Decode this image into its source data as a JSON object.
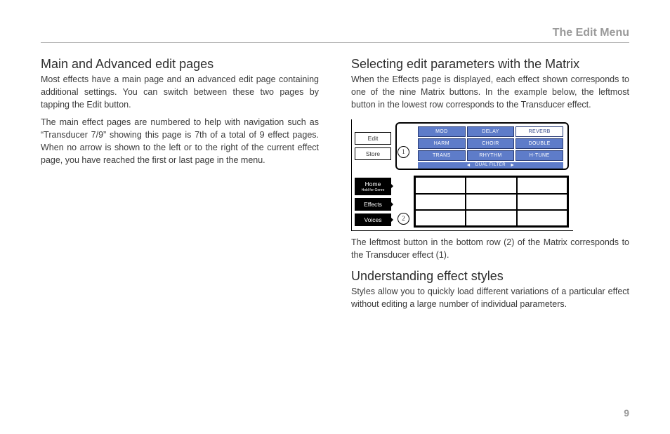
{
  "header": {
    "title": "The Edit Menu"
  },
  "left": {
    "sec1": {
      "title": "Main and Advanced edit pages",
      "p1": "Most effects have a main page and an advanced edit page containing additional settings. You can switch between these two pages by tapping the Edit button.",
      "p2": "The main effect pages are numbered to help with navigation such as “Transducer 7/9” showing this page is 7th of a total of 9 effect pages. When no arrow is shown to the left or to the right of the current effect page, you have reached the first or last page in the menu."
    }
  },
  "right": {
    "sec1": {
      "title": "Selecting edit parameters with the Matrix",
      "p1": "When the Effects page is displayed, each effect shown corresponds to one of the nine Matrix buttons. In the example below, the leftmost button in the lowest row corresponds to the Transducer effect."
    },
    "caption": "The leftmost button in the bottom row (2) of the Matrix corresponds to the Transducer effect (1).",
    "sec2": {
      "title": "Understanding effect styles",
      "p1": "Styles allow you to quickly load different variations of a particular effect without editing a large number of individual parameters."
    }
  },
  "device": {
    "sideTop": {
      "edit": "Edit",
      "store": "Store"
    },
    "sideBottom": {
      "home": "Home",
      "homeSub": "Hold for Genre",
      "effects": "Effects",
      "voices": "Voices"
    },
    "screen": {
      "cells": [
        "MOD",
        "DELAY",
        "REVERB",
        "HARM",
        "CHOIR",
        "DOUBLE",
        "TRANS",
        "RHYTHM",
        "H-TUNE"
      ],
      "footer": "DUAL FILTER"
    },
    "callout1": "1",
    "callout2": "2"
  },
  "pageNumber": "9"
}
